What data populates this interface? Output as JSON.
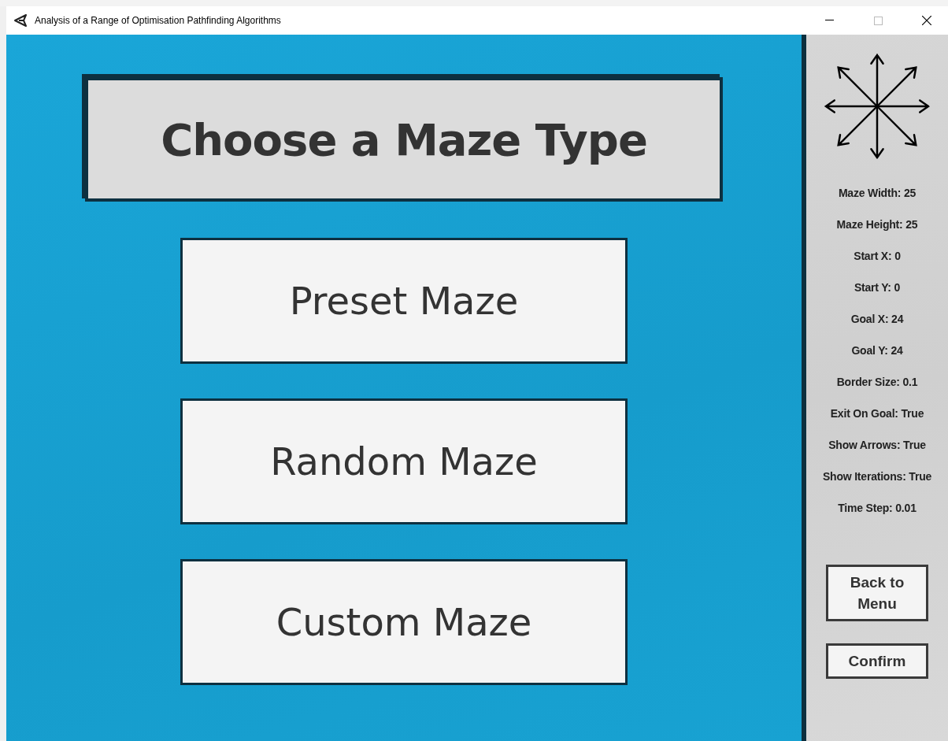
{
  "window": {
    "title": "Analysis of a Range of Optimisation Pathfinding Algorithms"
  },
  "heading": "Choose a Maze Type",
  "maze_buttons": [
    "Preset Maze",
    "Random Maze",
    "Custom Maze"
  ],
  "settings": [
    "Maze Width: 25",
    "Maze Height: 25",
    "Start X: 0",
    "Start Y: 0",
    "Goal X: 24",
    "Goal Y: 24",
    "Border Size: 0.1",
    "Exit On Goal: True",
    "Show Arrows: True",
    "Show Iterations: True",
    "Time Step: 0.01"
  ],
  "side_buttons": [
    "Back to Menu",
    "Confirm"
  ]
}
